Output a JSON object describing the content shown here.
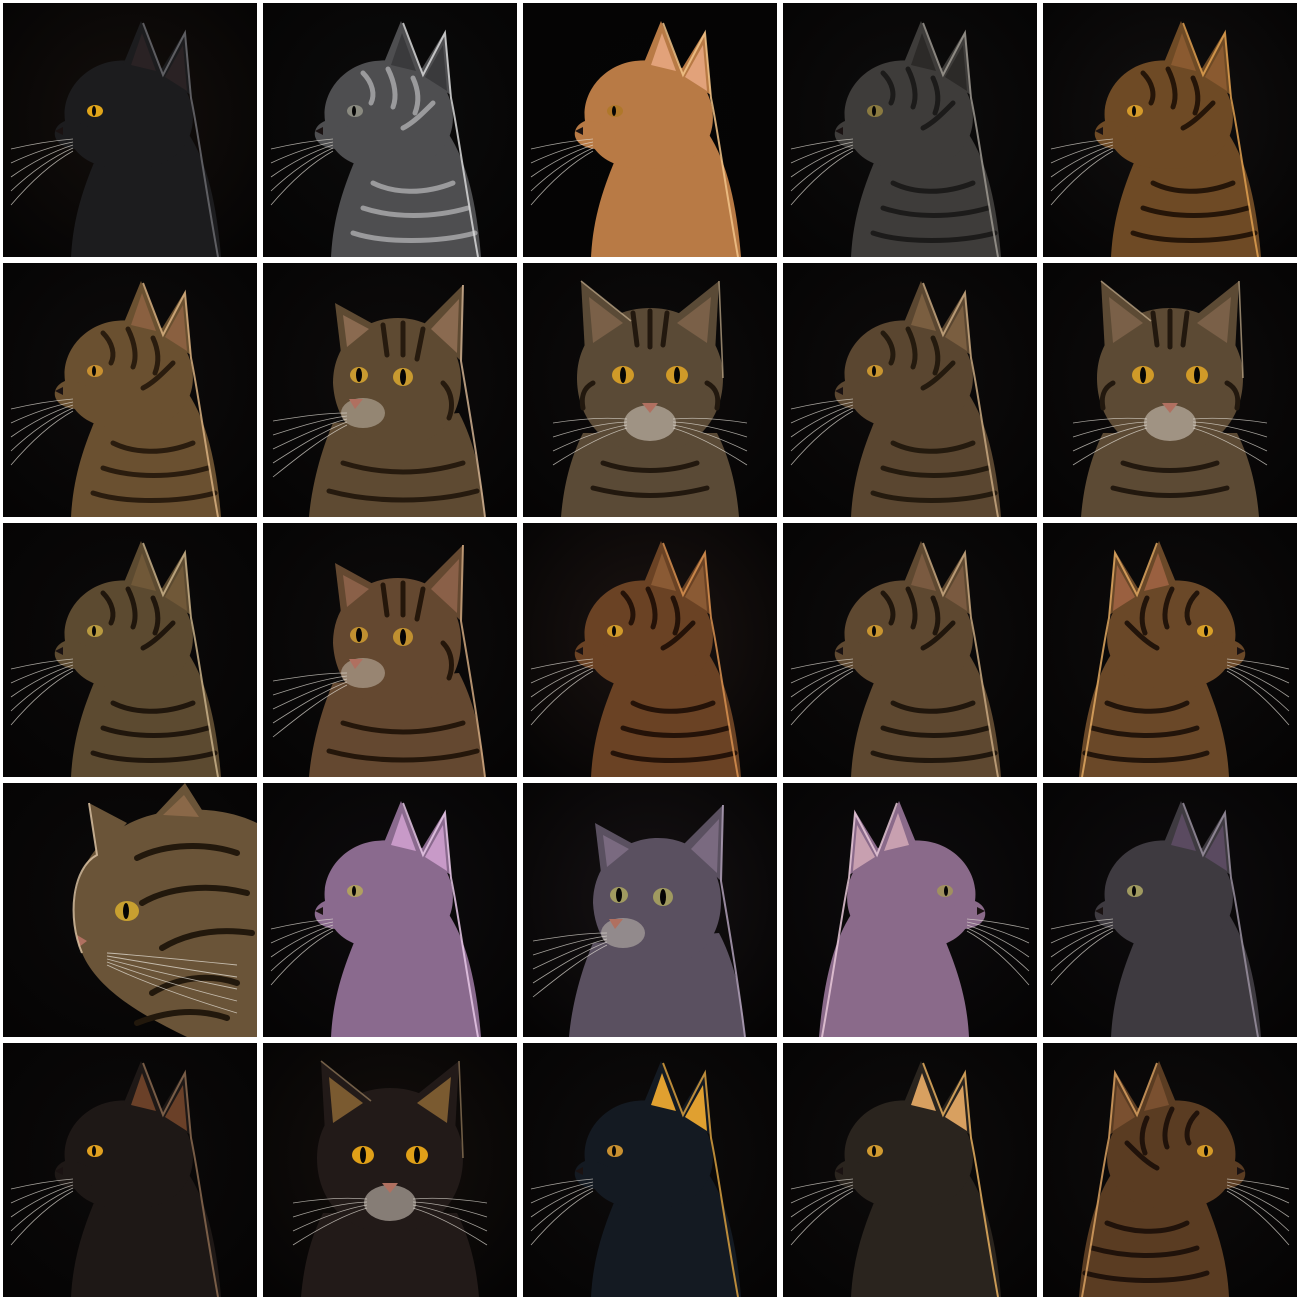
{
  "gallery": {
    "tiles": [
      {
        "subject": "black-cat-profile",
        "bg": "#140f0c",
        "fur": "#1c1c1e",
        "stripe": "#0e0e0f",
        "rim": "#6a6a6e",
        "eye": "#e0a51a",
        "ear": "#2a2224",
        "pose": "profile",
        "face": "left",
        "striped": false
      },
      {
        "subject": "silver-sketch-cat-profile",
        "bg": "#0c0c0c",
        "fur": "#4e4e50",
        "stripe": "#9a9a9c",
        "rim": "#d8d8d8",
        "eye": "#8a8a80",
        "ear": "#3a3a3c",
        "pose": "profile",
        "face": "left",
        "striped": true
      },
      {
        "subject": "orange-big-eared-cat-profile",
        "bg": "#050505",
        "fur": "#b87a45",
        "stripe": "#8a5430",
        "rim": "#f2c48a",
        "eye": "#b0782a",
        "ear": "#e2a27a",
        "pose": "profile",
        "face": "left",
        "striped": false
      },
      {
        "subject": "grey-tabby-cat-profile",
        "bg": "#0e0d0d",
        "fur": "#3e3c3a",
        "stripe": "#1c1b1a",
        "rim": "#9c9890",
        "eye": "#8a7a40",
        "ear": "#2c2a28",
        "pose": "profile",
        "face": "left",
        "striped": true
      },
      {
        "subject": "orange-tabby-cat-profile",
        "bg": "#121010",
        "fur": "#6e4a25",
        "stripe": "#251508",
        "rim": "#e0a050",
        "eye": "#d49a2a",
        "ear": "#8a5a30",
        "pose": "profile",
        "face": "left",
        "striped": true
      },
      {
        "subject": "brown-tabby-cat-profile",
        "bg": "#0e0c0c",
        "fur": "#6a5030",
        "stripe": "#2a1c0e",
        "rim": "#d8b080",
        "eye": "#c89030",
        "ear": "#8a6040",
        "pose": "profile",
        "face": "left",
        "striped": true
      },
      {
        "subject": "brown-tabby-cat-three-quarter",
        "bg": "#0e0c0c",
        "fur": "#5e4a32",
        "stripe": "#261a0e",
        "rim": "#d0b090",
        "eye": "#c89a30",
        "ear": "#8a6a50",
        "pose": "three-quarter",
        "face": "left",
        "striped": true
      },
      {
        "subject": "brown-tabby-cat-front",
        "bg": "#0e0c0c",
        "fur": "#5a4a36",
        "stripe": "#22180e",
        "rim": "#c8b090",
        "eye": "#d09a28",
        "ear": "#7a6048",
        "pose": "front",
        "face": "front",
        "striped": true
      },
      {
        "subject": "brown-tabby-cat-profile",
        "bg": "#0e0c0c",
        "fur": "#5a4630",
        "stripe": "#241a0e",
        "rim": "#c8a880",
        "eye": "#c89530",
        "ear": "#7a5e40",
        "pose": "profile",
        "face": "left",
        "striped": true
      },
      {
        "subject": "brown-tabby-cat-front",
        "bg": "#0e0c0c",
        "fur": "#5c4a34",
        "stripe": "#22180e",
        "rim": "#c8b090",
        "eye": "#d09a28",
        "ear": "#7a6048",
        "pose": "front",
        "face": "front",
        "striped": true
      },
      {
        "subject": "brown-tabby-cat-profile",
        "bg": "#0c0a0a",
        "fur": "#5c4a30",
        "stripe": "#20160c",
        "rim": "#c8b088",
        "eye": "#b89a40",
        "ear": "#705838",
        "pose": "profile",
        "face": "left",
        "striped": true
      },
      {
        "subject": "brown-tabby-kitten-three-quarter",
        "bg": "#0e0c0c",
        "fur": "#644830",
        "stripe": "#24160a",
        "rim": "#d0a880",
        "eye": "#c09030",
        "ear": "#8a6048",
        "pose": "three-quarter",
        "face": "left",
        "striped": true
      },
      {
        "subject": "orange-tabby-cat-profile",
        "bg": "#1c1412",
        "fur": "#6a4224",
        "stripe": "#241208",
        "rim": "#d89050",
        "eye": "#d09a2a",
        "ear": "#8a5a34",
        "pose": "profile",
        "face": "left",
        "striped": true
      },
      {
        "subject": "brown-tabby-cat-profile",
        "bg": "#0e0c0c",
        "fur": "#5e4830",
        "stripe": "#20160c",
        "rim": "#c8a880",
        "eye": "#c89530",
        "ear": "#7a5a40",
        "pose": "profile",
        "face": "left",
        "striped": true
      },
      {
        "subject": "orange-tabby-cat-profile-right",
        "bg": "#0e0c0c",
        "fur": "#6a4828",
        "stripe": "#22140a",
        "rim": "#e0a860",
        "eye": "#d8a028",
        "ear": "#9a6040",
        "pose": "profile",
        "face": "right",
        "striped": true
      },
      {
        "subject": "brown-tabby-cat-closeup-right",
        "bg": "#0c0a0a",
        "fur": "#6a5438",
        "stripe": "#22180c",
        "rim": "#d8c0a0",
        "eye": "#c8a030",
        "ear": "#8a6848",
        "pose": "closeup",
        "face": "right",
        "striped": true
      },
      {
        "subject": "lilac-sphynx-cat-profile",
        "bg": "#0e0c0e",
        "fur": "#8a6a8e",
        "stripe": "#6a4e70",
        "rim": "#e8c8e8",
        "eye": "#b0a060",
        "ear": "#c89ac8",
        "pose": "profile",
        "face": "left",
        "striped": false
      },
      {
        "subject": "grey-lilac-cat-three-quarter",
        "bg": "#161214",
        "fur": "#5a5060",
        "stripe": "#3a3240",
        "rim": "#b0a0b8",
        "eye": "#a09a60",
        "ear": "#7a6a80",
        "pose": "three-quarter",
        "face": "left",
        "striped": false
      },
      {
        "subject": "pink-sphynx-cat-profile-right",
        "bg": "#0e0c0e",
        "fur": "#8a6a8a",
        "stripe": "#5a3e60",
        "rim": "#e8c8d8",
        "eye": "#a09060",
        "ear": "#c8a0b0",
        "pose": "profile",
        "face": "right",
        "striped": false
      },
      {
        "subject": "grey-cat-profile",
        "bg": "#0e0c0e",
        "fur": "#3e3a40",
        "stripe": "#26232a",
        "rim": "#9a90a0",
        "eye": "#a09a60",
        "ear": "#5a4a60",
        "pose": "profile",
        "face": "left",
        "striped": false
      },
      {
        "subject": "black-cat-profile",
        "bg": "#0c0a0a",
        "fur": "#1e1816",
        "stripe": "#100c0a",
        "rim": "#8a6a50",
        "eye": "#e0a020",
        "ear": "#6a4028",
        "pose": "profile",
        "face": "left",
        "striped": false
      },
      {
        "subject": "black-cat-front",
        "bg": "#140f0c",
        "fur": "#221a18",
        "stripe": "#120e0c",
        "rim": "#9a8060",
        "eye": "#e0a018",
        "ear": "#7a5a30",
        "pose": "front",
        "face": "front",
        "striped": false
      },
      {
        "subject": "black-gold-geometric-cat-profile",
        "bg": "#0e0c0c",
        "fur": "#141a22",
        "stripe": "#2a3440",
        "rim": "#d8a040",
        "eye": "#c89030",
        "ear": "#e0a030",
        "pose": "profile",
        "face": "left",
        "striped": false
      },
      {
        "subject": "black-gold-cat-profile",
        "bg": "#0e0c0c",
        "fur": "#2a241e",
        "stripe": "#b07a30",
        "rim": "#e8b060",
        "eye": "#d09a30",
        "ear": "#d8a060",
        "pose": "profile",
        "face": "left",
        "striped": false
      },
      {
        "subject": "orange-tabby-cat-profile-right",
        "bg": "#0e0c0c",
        "fur": "#5a3c22",
        "stripe": "#20120a",
        "rim": "#d8a060",
        "eye": "#d49a28",
        "ear": "#7a5030",
        "pose": "profile",
        "face": "right",
        "striped": true
      }
    ]
  }
}
